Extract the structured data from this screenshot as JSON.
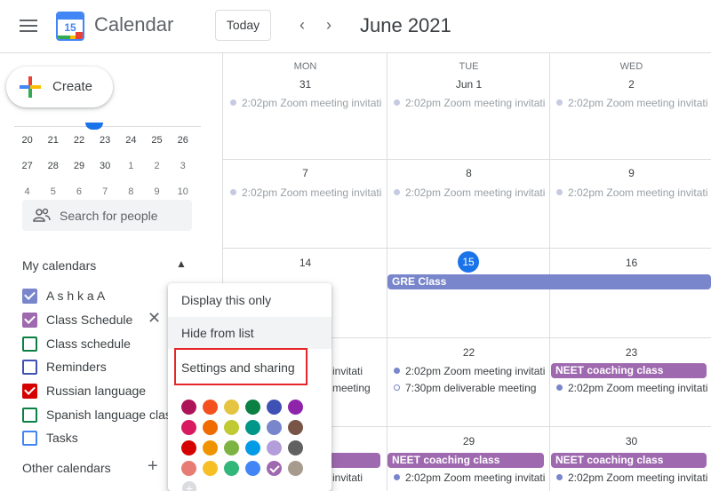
{
  "header": {
    "logo_day": "15",
    "app_title": "Calendar",
    "today_label": "Today",
    "prev_glyph": "‹",
    "next_glyph": "›",
    "month_title": "June 2021"
  },
  "sidebar": {
    "create_label": "Create",
    "mini_calendar": {
      "rows": [
        [
          "20",
          "21",
          "22",
          "23",
          "24",
          "25",
          "26"
        ],
        [
          "27",
          "28",
          "29",
          "30",
          "1",
          "2",
          "3"
        ],
        [
          "4",
          "5",
          "6",
          "7",
          "8",
          "9",
          "10"
        ]
      ]
    },
    "people_search_placeholder": "Search for people",
    "my_calendars_title": "My calendars",
    "my_calendars": [
      {
        "label": "A s h k a A",
        "color": "#7986cb",
        "checked": true
      },
      {
        "label": "Class Schedule",
        "color": "#9e69af",
        "checked": true
      },
      {
        "label": "Class schedule",
        "color": "#0b8043",
        "checked": false
      },
      {
        "label": "Reminders",
        "color": "#3f51b5",
        "checked": false
      },
      {
        "label": "Russian language",
        "color": "#d50000",
        "checked": true
      },
      {
        "label": "Spanish language class",
        "color": "#0b8043",
        "checked": false
      },
      {
        "label": "Tasks",
        "color": "#4285f4",
        "checked": false
      }
    ],
    "remove_glyph": "✕",
    "other_calendars_title": "Other calendars",
    "add_glyph": "+"
  },
  "grid": {
    "columns": [
      {
        "dow": "MON",
        "day": "31"
      },
      {
        "dow": "TUE",
        "day": "Jun 1"
      },
      {
        "dow": "WED",
        "day": "2"
      }
    ],
    "week2_days": [
      "7",
      "8",
      "9"
    ],
    "week3_days": [
      "14",
      "15",
      "16"
    ],
    "week4_days": [
      "22",
      "23"
    ],
    "week5_days": [
      "29",
      "30"
    ],
    "zoom_time": "2:02pm",
    "zoom_title": "Zoom meeting invitati",
    "gre_class": "GRE Class",
    "neet_class": "NEET coaching class",
    "partial_invitati": "invitati",
    "partial_meeting": "meeting",
    "deliverable_time": "7:30pm",
    "deliverable_title": "deliverable meeting",
    "colors": {
      "gre": "#7986cb",
      "neet": "#9e69af",
      "today": "#1a73e8"
    }
  },
  "context_menu": {
    "items": [
      "Display this only",
      "Hide from list",
      "Settings and sharing"
    ],
    "highlight_color": "#e5262a",
    "swatches": [
      [
        "#ad1457",
        "#f4511e",
        "#e4c441",
        "#0b8043",
        "#3f51b5",
        "#8e24aa"
      ],
      [
        "#d81b60",
        "#ef6c00",
        "#c0ca33",
        "#009688",
        "#7986cb",
        "#795548"
      ],
      [
        "#d50000",
        "#f09300",
        "#7cb342",
        "#039be5",
        "#b39ddb",
        "#616161"
      ],
      [
        "#e67c73",
        "#f6bf26",
        "#33b679",
        "#4285f4",
        "#9e69af",
        "#a79b8e"
      ]
    ],
    "selected_swatch": "#9e69af",
    "add_color_glyph": "+"
  }
}
